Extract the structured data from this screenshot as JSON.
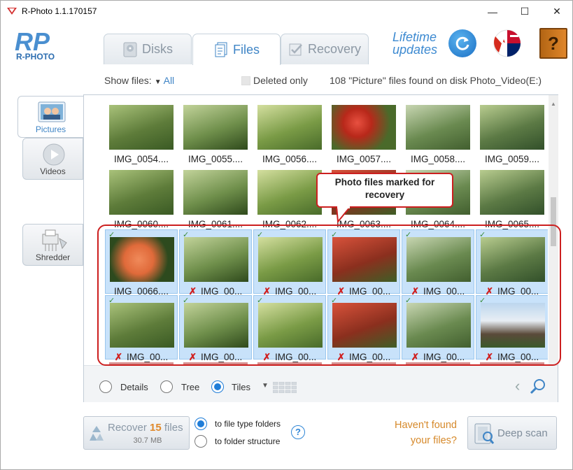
{
  "window": {
    "title": "R-Photo 1.1.170157",
    "controls": [
      "—",
      "☐",
      "✕"
    ]
  },
  "header": {
    "logo_text": "R-PHOTO",
    "tabs": [
      {
        "label": "Disks",
        "icon": "disk-icon"
      },
      {
        "label": "Files",
        "icon": "files-icon",
        "active": true
      },
      {
        "label": "Recovery",
        "icon": "recovery-icon"
      }
    ],
    "lifetime_line1": "Lifetime",
    "lifetime_line2": "updates",
    "help_glyph": "?"
  },
  "filter": {
    "show_files_label": "Show files:",
    "show_files_value": "All",
    "deleted_only_label": "Deleted only",
    "found_text": "108 \"Picture\" files found on disk Photo_Video(E:)"
  },
  "sidebar": {
    "pictures": "Pictures",
    "videos": "Videos",
    "shredder": "Shredder"
  },
  "files": {
    "row1": [
      "IMG_0054....",
      "IMG_0055....",
      "IMG_0056....",
      "IMG_0057....",
      "IMG_0058....",
      "IMG_0059...."
    ],
    "row2": [
      "IMG_0060....",
      "IMG_0061....",
      "IMG_0062....",
      "IMG_0063....",
      "IMG_0064....",
      "IMG_0065...."
    ],
    "row3": [
      "IMG_0066....",
      "IMG_00...",
      "IMG_00...",
      "IMG_00...",
      "IMG_00...",
      "IMG_00..."
    ],
    "row4": [
      "IMG_00...",
      "IMG_00...",
      "IMG_00...",
      "IMG_00...",
      "IMG_00...",
      "IMG_00..."
    ]
  },
  "callout": "Photo files marked for recovery",
  "viewbar": {
    "details": "Details",
    "tree": "Tree",
    "tiles": "Tiles"
  },
  "bottom": {
    "recover_prefix": "Recover",
    "recover_count": "15",
    "recover_suffix": "files",
    "recover_size": "30.7 MB",
    "dest_file_type": "to file type folders",
    "dest_folder_structure": "to folder structure",
    "havent_found": "Haven't found your files?",
    "deep_scan": "Deep scan"
  },
  "colors": {
    "accent": "#3f85c6",
    "selection": "#c8e2fa",
    "callout_red": "#cc1f1f",
    "orange": "#e0892b"
  }
}
